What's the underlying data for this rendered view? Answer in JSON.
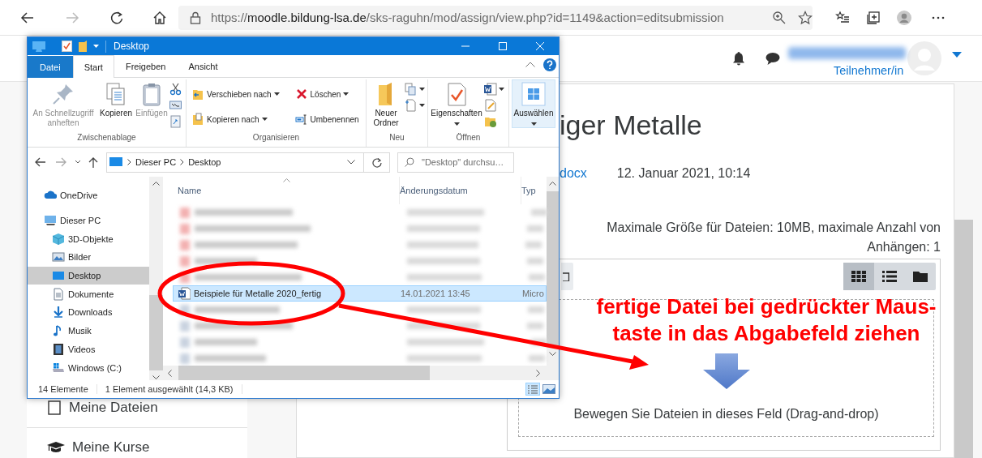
{
  "browser": {
    "url": {
      "scheme": "https://",
      "host": "moodle.bildung-lsa.de",
      "path": "/sks-raguhn/mod/assign/view.php?id=1149&action=editsubmission"
    }
  },
  "moodle": {
    "role": "Teilnehmer/in",
    "drawer": [
      {
        "label": "Meine Dateien"
      },
      {
        "label": "Meine Kurse"
      }
    ],
    "title": "iger Metalle",
    "file_link": "docx",
    "file_date": "12. Januar 2021, 10:14",
    "limits": "Maximale Größe für Dateien: 10MB, maximale Anzahl von Anhängen: 1",
    "view_buttons": [
      {
        "kind": "icons",
        "selected": true
      },
      {
        "kind": "list",
        "selected": false
      },
      {
        "kind": "tree",
        "selected": false
      }
    ],
    "dropzone": "Bewegen Sie Dateien in dieses Feld (Drag-and-drop)"
  },
  "explorer": {
    "title": "Desktop",
    "tabs": [
      {
        "label": "Datei",
        "kind": "file",
        "selected": false
      },
      {
        "label": "Start",
        "kind": "tab",
        "selected": true
      },
      {
        "label": "Freigeben",
        "kind": "tab",
        "selected": false
      },
      {
        "label": "Ansicht",
        "kind": "tab",
        "selected": false
      }
    ],
    "ribbon": [
      {
        "label": "Zwischenablage",
        "buttons": [
          {
            "label": "An Schnellzugriff anheften",
            "kind": "large",
            "dropdown": false,
            "disabled": true,
            "highlighted": false
          },
          {
            "label": "Kopieren",
            "kind": "large",
            "dropdown": false,
            "disabled": false,
            "highlighted": false
          },
          {
            "label": "Einfügen",
            "kind": "large",
            "dropdown": false,
            "disabled": true,
            "highlighted": false
          }
        ]
      },
      {
        "label": "Organisieren",
        "buttons": [
          {
            "label": "Verschieben nach",
            "kind": "small",
            "dropdown": true,
            "disabled": false,
            "highlighted": false
          },
          {
            "label": "Kopieren nach",
            "kind": "small",
            "dropdown": true,
            "disabled": false,
            "highlighted": false
          },
          {
            "label": "Löschen",
            "kind": "small",
            "dropdown": true,
            "disabled": false,
            "highlighted": false
          },
          {
            "label": "Umbenennen",
            "kind": "small",
            "dropdown": false,
            "disabled": false,
            "highlighted": false
          }
        ]
      },
      {
        "label": "Neu",
        "buttons": [
          {
            "label": "Neuer Ordner",
            "kind": "large",
            "dropdown": false,
            "disabled": false,
            "highlighted": false
          }
        ]
      },
      {
        "label": "Öffnen",
        "buttons": [
          {
            "label": "Eigenschaften",
            "kind": "large",
            "dropdown": true,
            "disabled": false,
            "highlighted": false
          }
        ]
      },
      {
        "buttons": [
          {
            "label": "Auswählen",
            "kind": "large",
            "dropdown": true,
            "disabled": false,
            "highlighted": true
          }
        ]
      }
    ],
    "path": [
      "Dieser PC",
      "Desktop"
    ],
    "search_placeholder": "\"Desktop\" durchsu…",
    "nav": [
      {
        "label": "OneDrive",
        "selected": false
      },
      {
        "label": "Dieser PC",
        "selected": false,
        "children": [
          {
            "label": "3D-Objekte",
            "selected": false
          },
          {
            "label": "Bilder",
            "selected": false
          },
          {
            "label": "Desktop",
            "selected": true
          },
          {
            "label": "Dokumente",
            "selected": false
          },
          {
            "label": "Downloads",
            "selected": false
          },
          {
            "label": "Musik",
            "selected": false
          },
          {
            "label": "Videos",
            "selected": false
          },
          {
            "label": "Windows (C:)",
            "selected": false
          }
        ]
      }
    ],
    "columns": [
      "Name",
      "Änderungsdatum",
      "Typ"
    ],
    "rows": [
      {
        "kind": "blurred",
        "selected": false
      },
      {
        "kind": "blurred",
        "selected": false
      },
      {
        "kind": "blurred",
        "selected": false
      },
      {
        "kind": "blurred",
        "selected": false
      },
      {
        "kind": "blurred",
        "selected": false
      },
      {
        "kind": "file",
        "name": "Beispiele für Metalle 2020_fertig",
        "date": "14.01.2021 13:45",
        "type": "Micro",
        "selected": true
      },
      {
        "kind": "blurred",
        "selected": false
      },
      {
        "kind": "blurred",
        "selected": false
      },
      {
        "kind": "blurred",
        "selected": false
      },
      {
        "kind": "blurred",
        "selected": false
      }
    ],
    "status": {
      "count": "14 Elemente",
      "selection": "1 Element ausgewählt (14,3 KB)"
    }
  },
  "annotation": {
    "text": "fertige Datei bei gedrückter Maus-\ntaste in das Abgabefeld ziehen"
  }
}
